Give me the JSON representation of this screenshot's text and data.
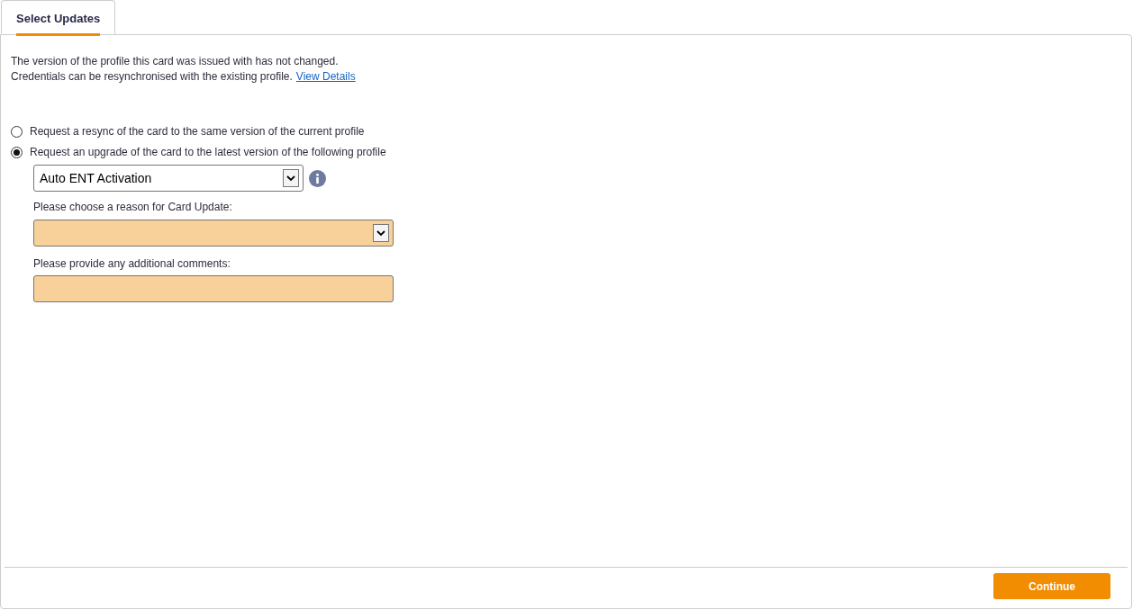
{
  "tabs": [
    {
      "label": "Select Updates",
      "selected": true
    }
  ],
  "message": {
    "line_1": "The version of the profile this card was issued with has not changed.",
    "line_2": "Credentials can be resynchronised with the existing profile.",
    "link": "View Details"
  },
  "options": [
    {
      "label": "Request a resync of the card to the same version of the current profile",
      "selected": false
    },
    {
      "label": "Request an upgrade of the card to the latest version of the following profile",
      "selected": true
    }
  ],
  "profile_select": {
    "value": "Auto ENT Activation"
  },
  "reason": {
    "label": "Please choose a reason for Card Update:"
  },
  "comments": {
    "label": "Please provide any additional comments:"
  },
  "continue_button": "Continue"
}
